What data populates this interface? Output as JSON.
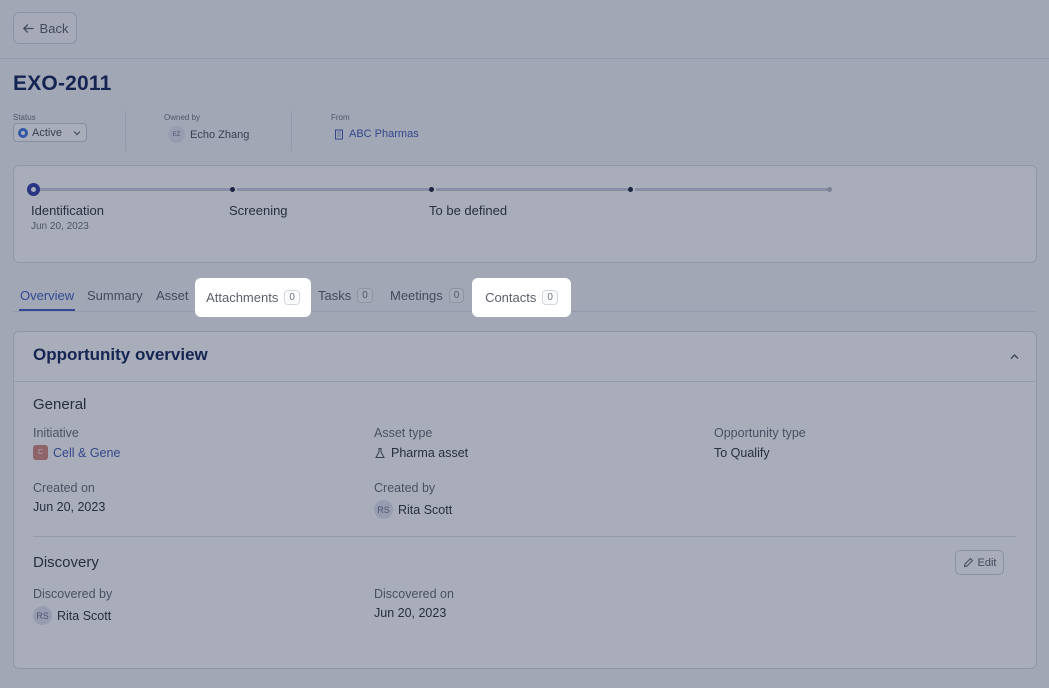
{
  "nav": {
    "back_label": "Back"
  },
  "header": {
    "title": "EXO-2011",
    "status": {
      "label": "Status",
      "value": "Active"
    },
    "owner": {
      "label": "Owned by",
      "initials": "EZ",
      "name": "Echo Zhang"
    },
    "from": {
      "label": "From",
      "value": "ABC Pharmas"
    }
  },
  "stages": [
    {
      "name": "Identification",
      "date": "Jun 20, 2023"
    },
    {
      "name": "Screening",
      "date": ""
    },
    {
      "name": "To be defined",
      "date": ""
    }
  ],
  "tabs": [
    {
      "label": "Overview"
    },
    {
      "label": "Summary"
    },
    {
      "label": "Asset"
    },
    {
      "label": "Attachments",
      "count": "0"
    },
    {
      "label": "Tasks",
      "count": "0"
    },
    {
      "label": "Meetings",
      "count": "0"
    },
    {
      "label": "Contacts",
      "count": "0"
    }
  ],
  "overview": {
    "title": "Opportunity overview",
    "general": {
      "title": "General",
      "initiative": {
        "label": "Initiative",
        "badge": "C",
        "value": "Cell & Gene"
      },
      "asset_type": {
        "label": "Asset type",
        "value": "Pharma asset"
      },
      "opportunity_type": {
        "label": "Opportunity type",
        "value": "To Qualify"
      },
      "created_on": {
        "label": "Created on",
        "value": "Jun 20, 2023"
      },
      "created_by": {
        "label": "Created by",
        "initials": "RS",
        "value": "Rita Scott"
      }
    },
    "discovery": {
      "title": "Discovery",
      "edit_label": "Edit",
      "discovered_by": {
        "label": "Discovered by",
        "initials": "RS",
        "value": "Rita Scott"
      },
      "discovered_on": {
        "label": "Discovered on",
        "value": "Jun 20, 2023"
      }
    }
  }
}
